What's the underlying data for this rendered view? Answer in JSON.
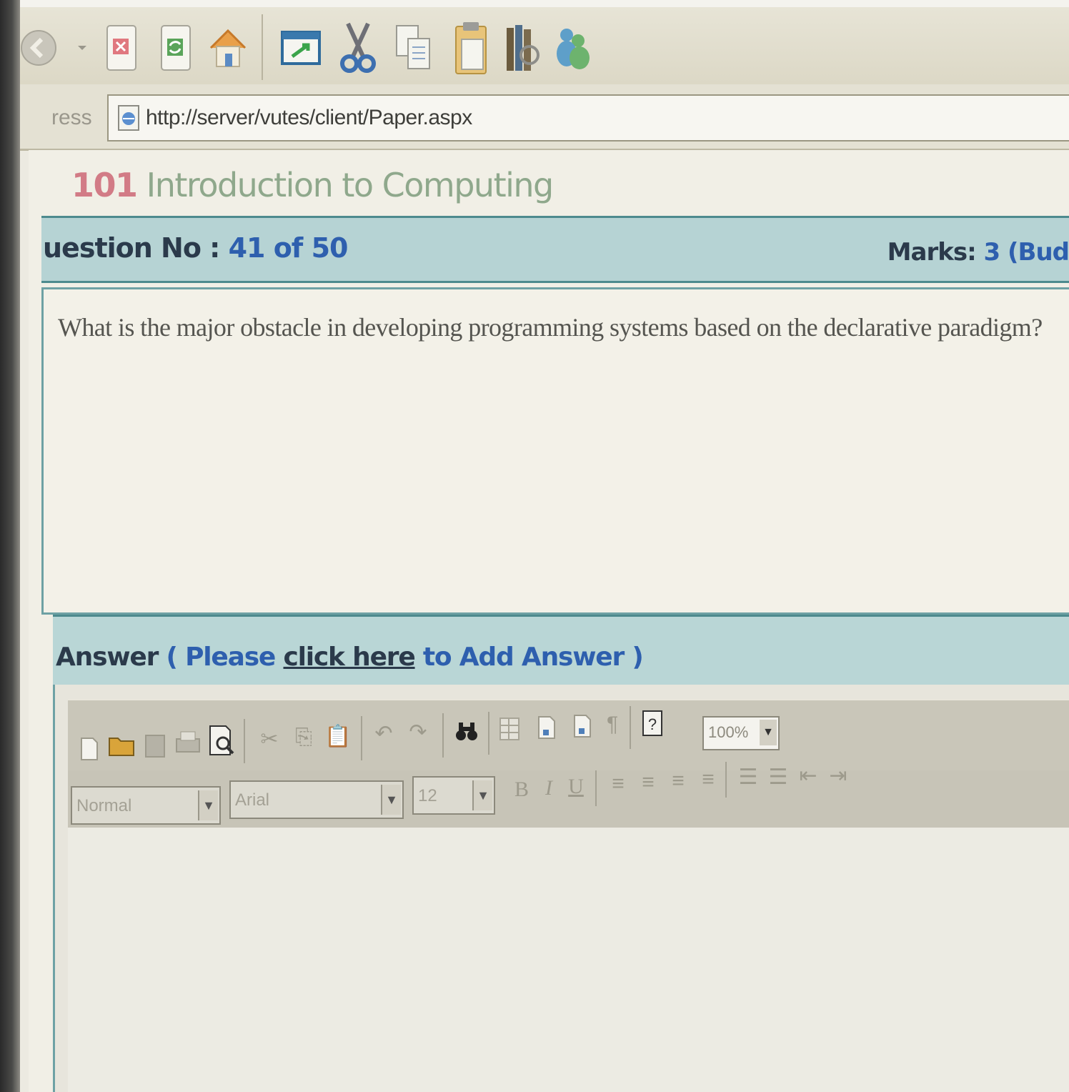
{
  "browser": {
    "address_label": "ress",
    "url": "http://server/vutes/client/Paper.aspx",
    "toolbar_icons": [
      "back-icon",
      "stop-icon",
      "refresh-icon",
      "home-icon",
      "edit-page-icon",
      "cut-icon",
      "copy-icon",
      "paste-icon",
      "library-icon",
      "messenger-icon"
    ]
  },
  "course": {
    "code": "101",
    "title": "Introduction to Computing"
  },
  "question": {
    "label": "uestion No : ",
    "number": "41 of 50",
    "marks_label": "Marks: ",
    "marks_value": "3 (Bud",
    "text": "What is the major obstacle in developing programming systems based on the declarative paradigm?"
  },
  "answer": {
    "label": "Answer",
    "open": " ( Please ",
    "link": "click here",
    "rest": " to Add Answer )"
  },
  "editor": {
    "zoom": "100%",
    "style_select": "Normal",
    "font_select": "Arial",
    "size_select": "12",
    "bold": "B",
    "italic": "I",
    "underline": "U"
  }
}
